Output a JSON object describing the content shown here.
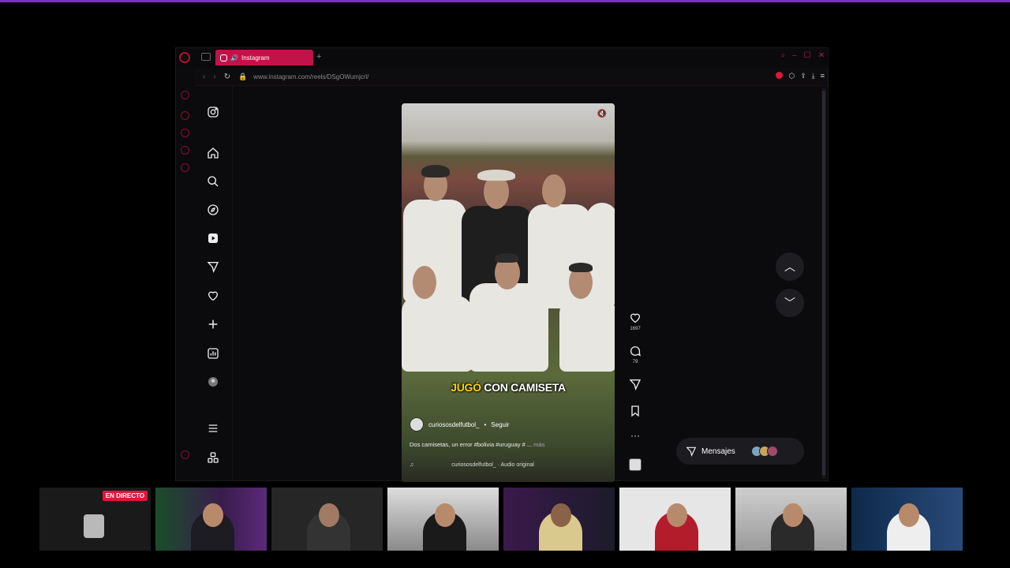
{
  "browser": {
    "tab_title": "Instagram",
    "new_tab": "+",
    "url": "www.instagram.com/reels/DSgOWumjcrl/"
  },
  "reel": {
    "caption_overlay_highlight": "JUGÓ",
    "caption_overlay_rest": " CON CAMISETA",
    "author": "curiososdelfutbol_",
    "follow_label": "Seguir",
    "description": "Dos camisetas, un error #bolivia #uruguay # ...",
    "more_label": "más",
    "audio": "curiososdelfutbol_ · Audio original",
    "likes": "1697",
    "comments": "79"
  },
  "messages": {
    "label": "Mensajes"
  },
  "stream": {
    "live_badge": "EN DIRECTO"
  },
  "colors": {
    "accent": "#c2124a",
    "live": "#e0163b",
    "stream_border": "#7b2fd4"
  }
}
